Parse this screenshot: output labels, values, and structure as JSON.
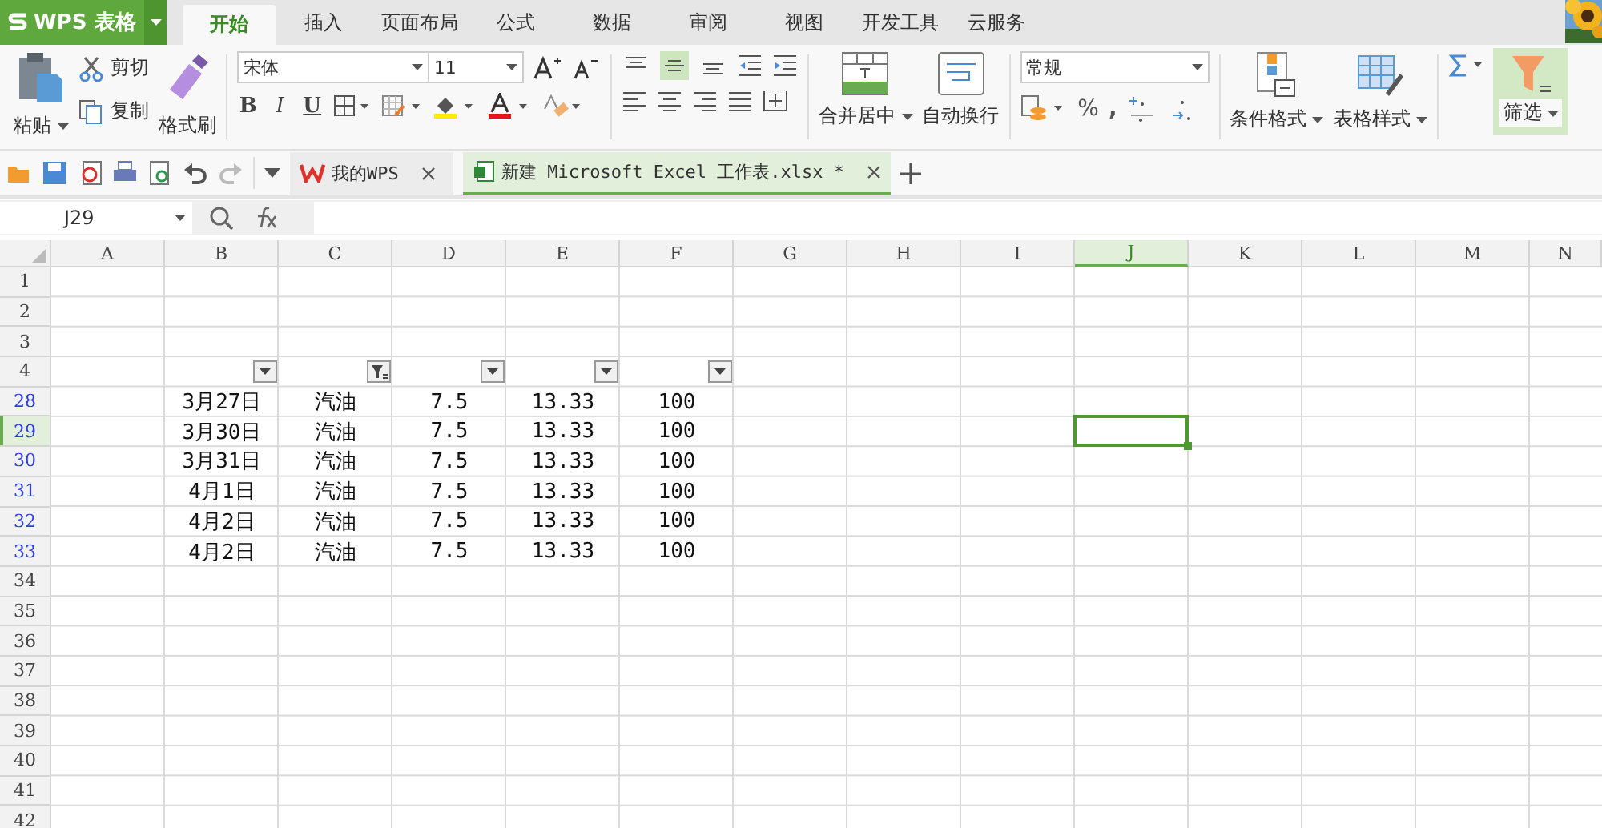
{
  "app_menu": {
    "label": "WPS 表格"
  },
  "ribbon_tabs": [
    {
      "label": "开始",
      "selected": true
    },
    {
      "label": "插入",
      "selected": false
    },
    {
      "label": "页面布局",
      "selected": false
    },
    {
      "label": "公式",
      "selected": false
    },
    {
      "label": "数据",
      "selected": false
    },
    {
      "label": "审阅",
      "selected": false
    },
    {
      "label": "视图",
      "selected": false
    },
    {
      "label": "开发工具",
      "selected": false
    },
    {
      "label": "云服务",
      "selected": false
    }
  ],
  "clipboard": {
    "paste": "粘贴",
    "cut": "剪切",
    "copy": "复制",
    "format_painter": "格式刷"
  },
  "font": {
    "name": "宋体",
    "size": "11",
    "bold": "B",
    "italic": "I",
    "underline": "U"
  },
  "alignment": {
    "vertical": [
      {
        "selected": false
      },
      {
        "selected": true
      },
      {
        "selected": false
      }
    ],
    "merge": "合并居中",
    "wrap": "自动换行"
  },
  "number": {
    "format": "常规",
    "percent": "%",
    "comma": ","
  },
  "styles": {
    "conditional": "条件格式",
    "table_style": "表格样式"
  },
  "editing": {
    "filter": {
      "label": "筛选",
      "on": true
    }
  },
  "document_tabs": [
    {
      "label": "我的WPS",
      "selected": false
    },
    {
      "label": "新建 Microsoft Excel 工作表.xlsx *",
      "selected": true
    }
  ],
  "name_box": "J29",
  "sheet": {
    "columns": [
      {
        "label": "A",
        "selected": false
      },
      {
        "label": "B",
        "selected": false
      },
      {
        "label": "C",
        "selected": false
      },
      {
        "label": "D",
        "selected": false
      },
      {
        "label": "E",
        "selected": false
      },
      {
        "label": "F",
        "selected": false
      },
      {
        "label": "G",
        "selected": false
      },
      {
        "label": "H",
        "selected": false
      },
      {
        "label": "I",
        "selected": false
      },
      {
        "label": "J",
        "selected": true
      },
      {
        "label": "K",
        "selected": false
      },
      {
        "label": "L",
        "selected": false
      },
      {
        "label": "M",
        "selected": false
      },
      {
        "label": "N",
        "selected": false
      }
    ],
    "rows": [
      {
        "number": "1",
        "filtered": false,
        "selected": false
      },
      {
        "number": "2",
        "filtered": false,
        "selected": false
      },
      {
        "number": "3",
        "filtered": false,
        "selected": false
      },
      {
        "number": "4",
        "filtered": false,
        "selected": false,
        "filters": [
          {
            "kind": "dropdown"
          },
          {
            "kind": "filtered"
          },
          {
            "kind": "dropdown"
          },
          {
            "kind": "dropdown"
          },
          {
            "kind": "dropdown"
          }
        ]
      },
      {
        "number": "28",
        "filtered": true,
        "selected": false,
        "values": [
          "3月27日",
          "汽油",
          "7.5",
          "13.33",
          "100"
        ]
      },
      {
        "number": "29",
        "filtered": true,
        "selected": true,
        "values": [
          "3月30日",
          "汽油",
          "7.5",
          "13.33",
          "100"
        ]
      },
      {
        "number": "30",
        "filtered": true,
        "selected": false,
        "values": [
          "3月31日",
          "汽油",
          "7.5",
          "13.33",
          "100"
        ]
      },
      {
        "number": "31",
        "filtered": true,
        "selected": false,
        "values": [
          "4月1日",
          "汽油",
          "7.5",
          "13.33",
          "100"
        ]
      },
      {
        "number": "32",
        "filtered": true,
        "selected": false,
        "values": [
          "4月2日",
          "汽油",
          "7.5",
          "13.33",
          "100"
        ]
      },
      {
        "number": "33",
        "filtered": true,
        "selected": false,
        "values": [
          "4月2日",
          "汽油",
          "7.5",
          "13.33",
          "100"
        ]
      },
      {
        "number": "34",
        "filtered": false,
        "selected": false
      },
      {
        "number": "35",
        "filtered": false,
        "selected": false
      },
      {
        "number": "36",
        "filtered": false,
        "selected": false
      },
      {
        "number": "37",
        "filtered": false,
        "selected": false
      },
      {
        "number": "38",
        "filtered": false,
        "selected": false
      },
      {
        "number": "39",
        "filtered": false,
        "selected": false
      },
      {
        "number": "40",
        "filtered": false,
        "selected": false
      },
      {
        "number": "41",
        "filtered": false,
        "selected": false
      },
      {
        "number": "42",
        "filtered": false,
        "selected": false
      }
    ]
  }
}
